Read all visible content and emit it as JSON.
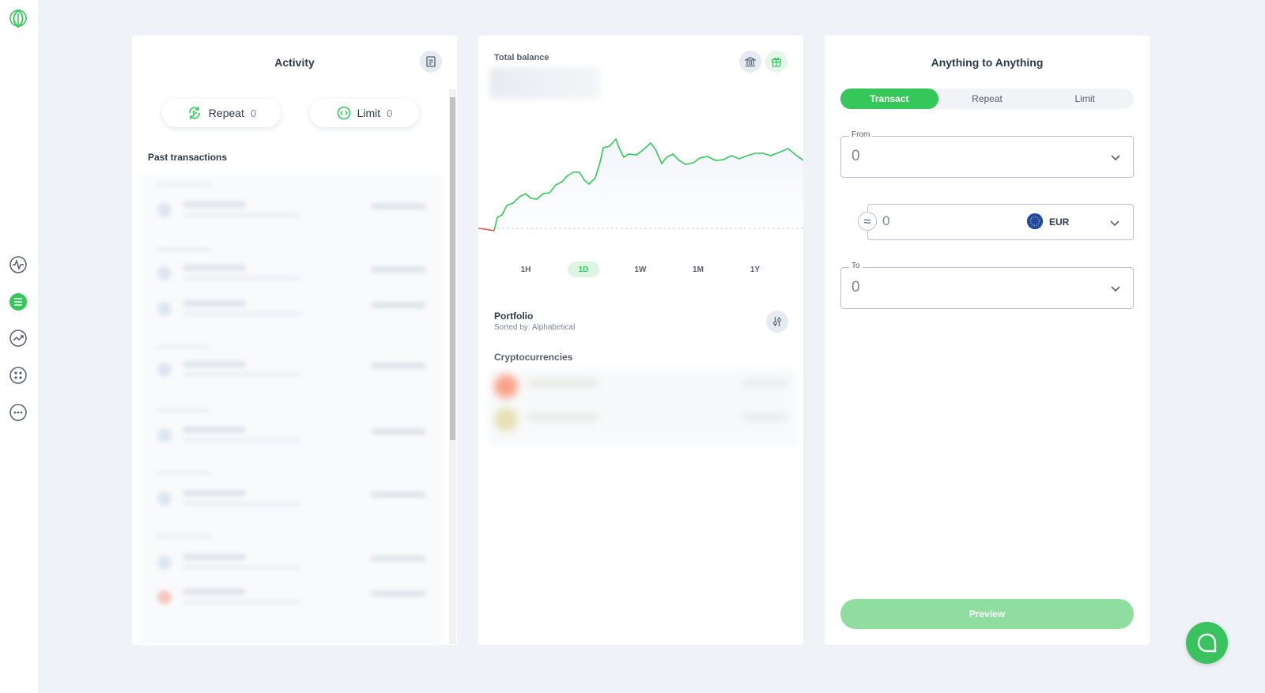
{
  "sidebar": {
    "items": [
      {
        "icon": "logo-icon"
      },
      {
        "icon": "activity-pulse-icon"
      },
      {
        "icon": "list-icon",
        "active": true
      },
      {
        "icon": "trend-chart-icon"
      },
      {
        "icon": "apps-grid-icon"
      },
      {
        "icon": "more-dots-icon"
      }
    ]
  },
  "activity": {
    "title": "Activity",
    "repeat_label": "Repeat",
    "repeat_count": "0",
    "limit_label": "Limit",
    "limit_count": "0",
    "past_label": "Past transactions"
  },
  "balance": {
    "label": "Total balance",
    "timeframes": [
      "1H",
      "1D",
      "1W",
      "1M",
      "1Y"
    ],
    "active_timeframe": "1D",
    "portfolio_title": "Portfolio",
    "portfolio_sort": "Sorted by: Alphabetical",
    "crypto_label": "Cryptocurrencies",
    "colors": {
      "line": "#35c75a",
      "negative": "#e5533d"
    }
  },
  "a2a": {
    "title": "Anything to Anything",
    "tabs": [
      "Transact",
      "Repeat",
      "Limit"
    ],
    "active_tab": "Transact",
    "from_label": "From",
    "from_value": "0",
    "amount_value": "0",
    "currency": "EUR",
    "to_label": "To",
    "to_value": "0",
    "preview_label": "Preview"
  },
  "colors": {
    "accent": "#35c75a",
    "preview_disabled": "#8fde9f",
    "background": "#eff2f6"
  }
}
